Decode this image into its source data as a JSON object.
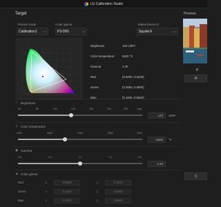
{
  "app": {
    "title": "LG Calibration Studio"
  },
  "target": {
    "section_title": "Target",
    "picture_mode": {
      "label": "Picture mode",
      "value": "Calibration1"
    },
    "color_gamut": {
      "label": "Color gamut",
      "value": "P3-D65"
    },
    "maker": {
      "label": "Maker(Sensor)",
      "value": "SpyderX"
    }
  },
  "stats": [
    {
      "label": "Brightness",
      "value": "120 cd/m²"
    },
    {
      "label": "Color temperature",
      "value": "6500 °K"
    },
    {
      "label": "Gamma",
      "value": "2.20"
    },
    {
      "label": "Red",
      "value": "(0.6800, 0.3200)"
    },
    {
      "label": "Green",
      "value": "(0.2650, 0.6900)"
    },
    {
      "label": "Blue",
      "value": "(0.1500, 0.0600)"
    }
  ],
  "brightness": {
    "label": "Brightness",
    "ticks": [
      "50",
      "80",
      "100",
      "120",
      "150",
      "200",
      "250",
      "Max"
    ],
    "value": "120",
    "unit": "cd/m²",
    "level": 0.43
  },
  "color_temperature": {
    "label": "Color temperature",
    "ticks": [
      "5000",
      "6000",
      "7000",
      "8000",
      "9000"
    ],
    "value": "6500",
    "unit": "°K",
    "level": 0.375
  },
  "gamma": {
    "label": "Gamma",
    "ticks": [
      "1.8",
      "2.0",
      "2.2",
      "2.4",
      "2.6"
    ],
    "value": "2.20",
    "level": 0.5
  },
  "color_gamut_section": {
    "label": "Color gamut",
    "rows": [
      {
        "name": "Red",
        "x_label": "x",
        "x_value": "0.6800",
        "y_label": "y",
        "y_value": "0.3200"
      },
      {
        "name": "Green",
        "x_label": "x",
        "x_value": "0.2650",
        "y_label": "y",
        "y_value": "0.6900"
      },
      {
        "name": "Blue",
        "x_label": "x",
        "x_value": "0.1500",
        "y_label": "y",
        "y_value": "0.0600"
      }
    ]
  },
  "preview": {
    "title": "Preview",
    "caption": "P",
    "button_label": "R",
    "bottom_button_label": "C"
  },
  "colors": {
    "background": "#1e1e1e",
    "panel": "#262626",
    "accent": "#d8d8d8"
  },
  "icons": [
    "lg-logo-icon",
    "chevron-down-icon",
    "brightness-icon",
    "color-temperature-icon",
    "gamma-icon",
    "color-gamut-icon"
  ]
}
